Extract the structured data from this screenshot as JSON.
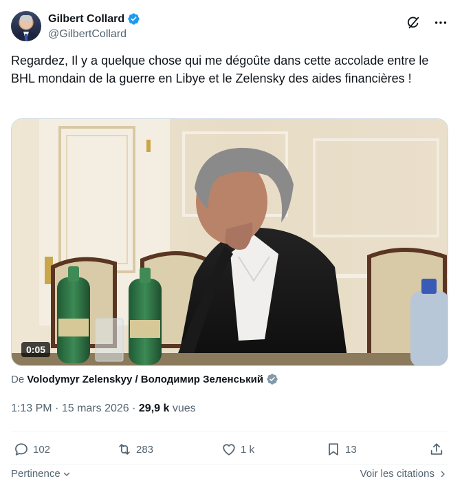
{
  "author": {
    "display_name": "Gilbert Collard",
    "handle": "@GilbertCollard"
  },
  "tweet": {
    "text": "Regardez, Il y a quelque chose qui me dégoûte dans cette accolade entre le BHL mondain de la guerre en Libye et le Zelensky des aides financières !"
  },
  "media": {
    "duration": "0:05"
  },
  "attribution": {
    "prefix": "De",
    "source": "Volodymyr Zelenskyy / Володимир Зеленський"
  },
  "meta": {
    "time": "1:13 PM",
    "separator": "·",
    "date": "15 mars 2026",
    "views_count": "29,9 k",
    "views_label": "vues"
  },
  "actions": {
    "replies": "102",
    "reposts": "283",
    "likes": "1 k",
    "bookmarks": "13"
  },
  "footer": {
    "sort_label": "Pertinence",
    "quotes_label": "Voir les citations"
  },
  "colors": {
    "verified_blue": "#1d9bf0",
    "text_primary": "#0f1419",
    "text_secondary": "#536471"
  }
}
